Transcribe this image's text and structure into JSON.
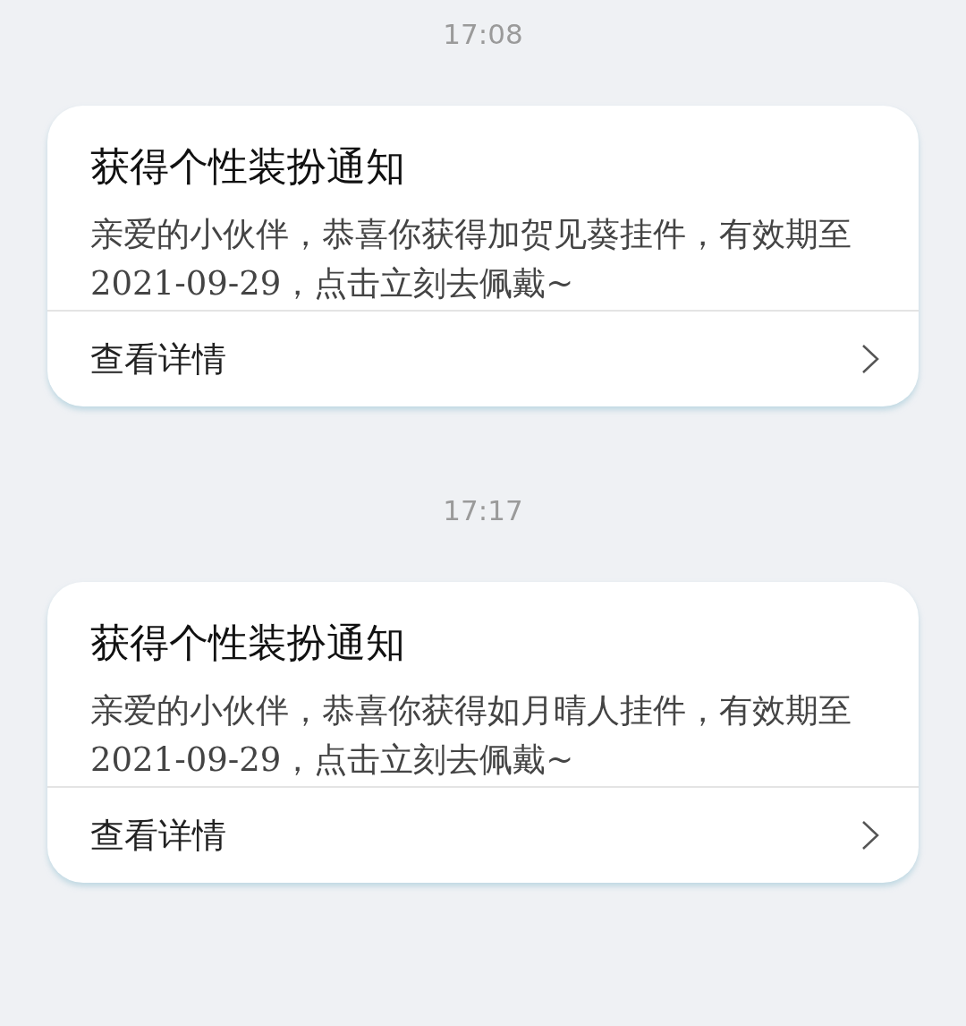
{
  "messages": [
    {
      "time": "17:08",
      "title": "获得个性装扮通知",
      "body": "亲爱的小伙伴，恭喜你获得加贺见葵挂件，有效期至2021-09-29，点击立刻去佩戴~",
      "link": "查看详情"
    },
    {
      "time": "17:17",
      "title": "获得个性装扮通知",
      "body": "亲爱的小伙伴，恭喜你获得如月晴人挂件，有效期至2021-09-29，点击立刻去佩戴~",
      "link": "查看详情"
    }
  ]
}
